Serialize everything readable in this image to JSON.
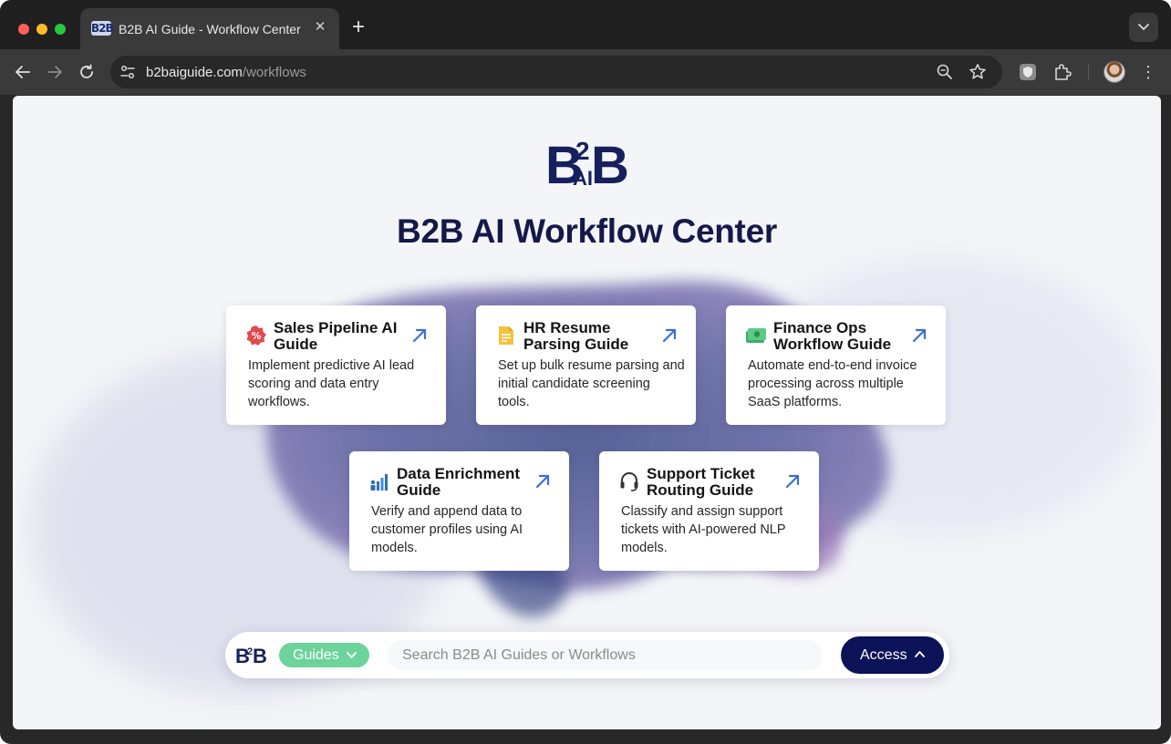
{
  "browser": {
    "tab_title": "B2B AI Guide - Workflow Center",
    "tab_favicon_text": "B2B",
    "new_tab": "+",
    "url_host": "b2baiguide.com",
    "url_path": "/workflows"
  },
  "header": {
    "logo_text": "B2B AI",
    "title": "B2B AI Workflow Center"
  },
  "cards": [
    {
      "title": "Sales Pipeline AI Guide",
      "description": "Implement predictive AI lead scoring and data entry workflows.",
      "icon": "percent-badge-icon"
    },
    {
      "title": "HR Resume Parsing Guide",
      "description": "Set up bulk resume parsing and initial candidate screening tools.",
      "icon": "document-icon"
    },
    {
      "title": "Finance Ops Workflow Guide",
      "description": "Automate end-to-end invoice processing across multiple SaaS platforms.",
      "icon": "money-icon"
    },
    {
      "title": "Data Enrichment Guide",
      "description": "Verify and append data to customer profiles using AI models.",
      "icon": "people-chart-icon"
    },
    {
      "title": "Support Ticket Routing Guide",
      "description": "Classify and assign support tickets with AI-powered NLP models.",
      "icon": "headset-icon"
    }
  ],
  "searchbar": {
    "logo_text": "B2B",
    "filter_label": "Guides",
    "placeholder": "Search B2B AI Guides or Workflows",
    "value": "",
    "action_label": "Access"
  },
  "colors": {
    "brand_navy": "#0b1257",
    "accent_green": "#6cd39a",
    "arrow_blue": "#3b6fd6"
  }
}
